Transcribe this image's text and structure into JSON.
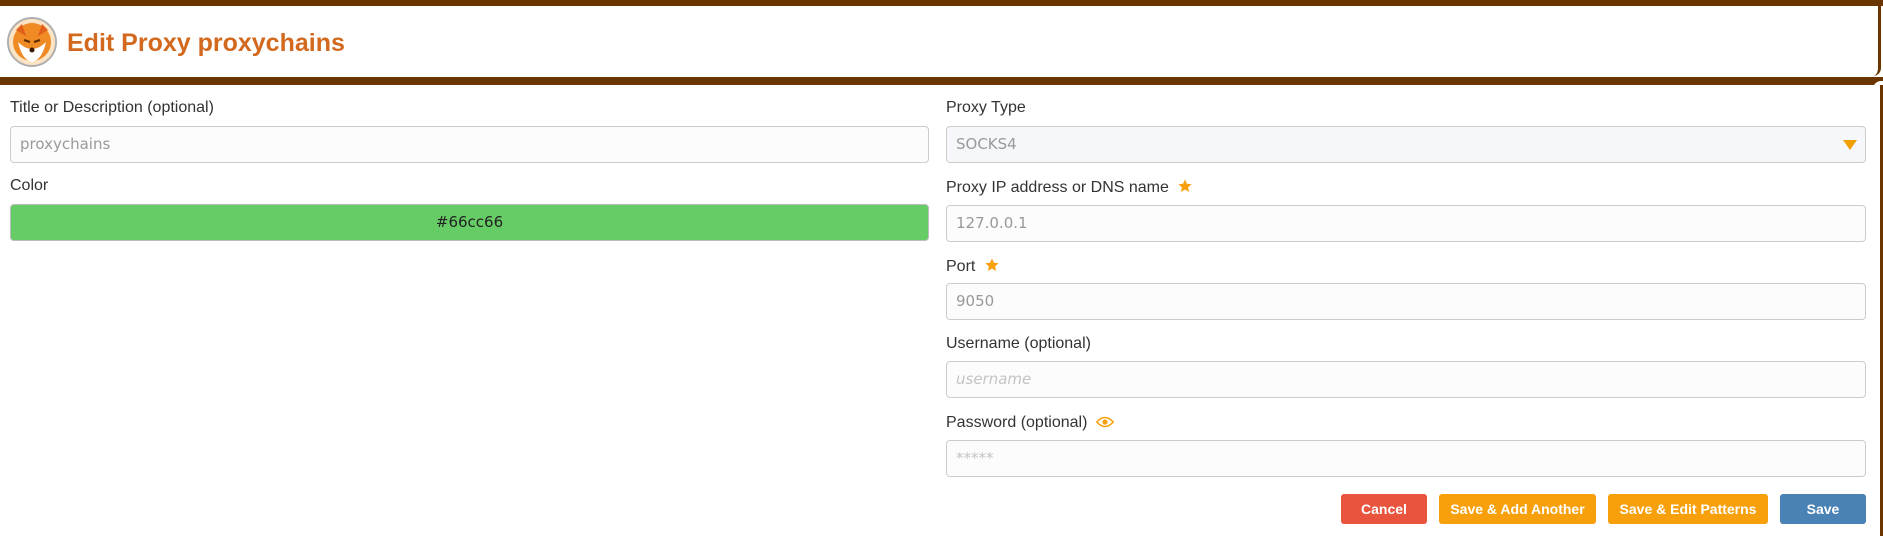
{
  "header": {
    "title": "Edit Proxy proxychains",
    "logo_icon": "firefox-fox-logo"
  },
  "form": {
    "title_field": {
      "label": "Title or Description (optional)",
      "value": "proxychains"
    },
    "color_field": {
      "label": "Color",
      "value": "#66cc66"
    },
    "proxy_type": {
      "label": "Proxy Type",
      "value": "SOCKS4"
    },
    "proxy_address": {
      "label": "Proxy IP address or DNS name",
      "value": "127.0.0.1",
      "required_icon": "star-icon"
    },
    "port": {
      "label": "Port",
      "value": "9050",
      "required_icon": "star-icon"
    },
    "username": {
      "label": "Username (optional)",
      "placeholder": "username"
    },
    "password": {
      "label": "Password (optional)",
      "placeholder": "*****",
      "toggle_icon": "eye-icon"
    }
  },
  "buttons": {
    "cancel": "Cancel",
    "save_add_another": "Save & Add Another",
    "save_edit_patterns": "Save & Edit Patterns",
    "save": "Save"
  },
  "colors": {
    "frame": "#6b3500",
    "title": "#d2691e",
    "accent_orange": "#f7a00c",
    "cancel_red": "#e8543d",
    "save_blue": "#4a82b5",
    "swatch": "#66cc66"
  }
}
